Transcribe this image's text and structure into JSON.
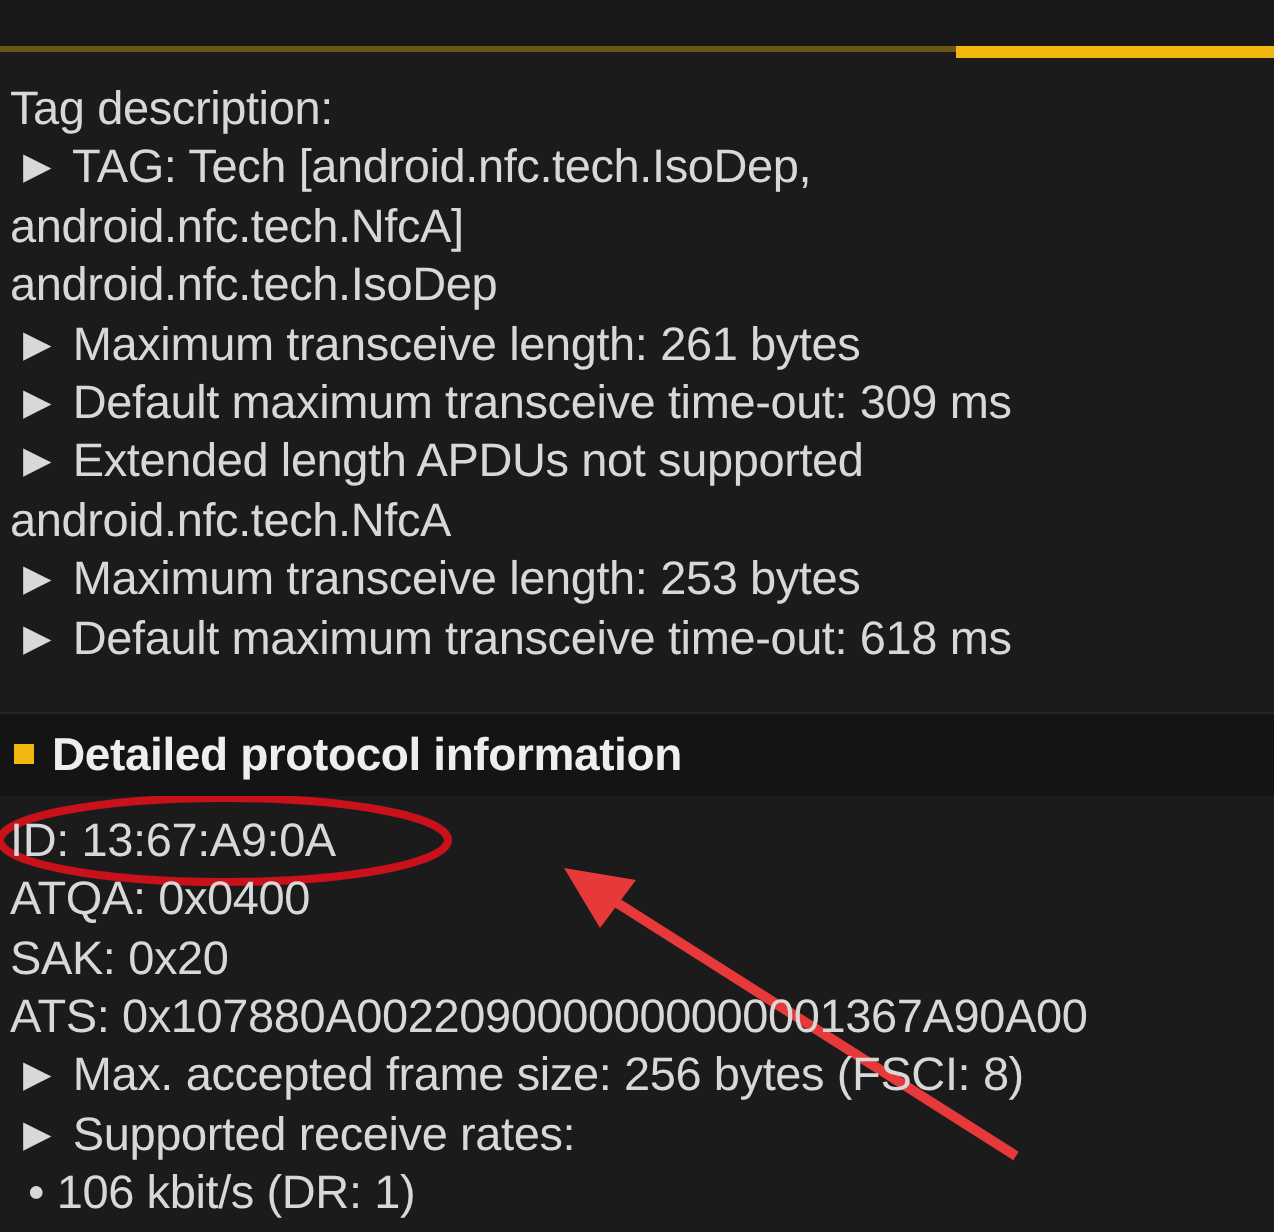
{
  "tabs": [
    {
      "selected": false
    },
    {
      "selected": false
    },
    {
      "selected": false
    },
    {
      "selected": true
    }
  ],
  "tag_description": {
    "heading": "Tag description:",
    "lines": [
      {
        "kind": "bullet",
        "text": "► TAG: Tech [android.nfc.tech.IsoDep,"
      },
      {
        "kind": "plain",
        "text": "android.nfc.tech.NfcA]"
      },
      {
        "kind": "plain",
        "text": "android.nfc.tech.IsoDep"
      },
      {
        "kind": "bullet",
        "text": "► Maximum transceive length: 261 bytes"
      },
      {
        "kind": "bullet",
        "text": "► Default maximum transceive time-out: 309 ms"
      },
      {
        "kind": "bullet",
        "text": "► Extended length APDUs not supported"
      },
      {
        "kind": "plain",
        "text": "android.nfc.tech.NfcA"
      },
      {
        "kind": "bullet",
        "text": "► Maximum transceive length: 253 bytes"
      },
      {
        "kind": "bullet",
        "text": "► Default maximum transceive time-out: 618 ms"
      }
    ]
  },
  "protocol_section": {
    "title": "Detailed protocol information",
    "lines": [
      {
        "kind": "plain",
        "text": "ID: 13:67:A9:0A"
      },
      {
        "kind": "plain",
        "text": "ATQA: 0x0400"
      },
      {
        "kind": "plain",
        "text": "SAK: 0x20"
      },
      {
        "kind": "plain",
        "text": "ATS: 0x107880A0022090000000000001367A90A00"
      },
      {
        "kind": "bullet",
        "text": "► Max. accepted frame size: 256 bytes (FSCI: 8)"
      },
      {
        "kind": "bullet",
        "text": "► Supported receive rates:"
      },
      {
        "kind": "dot",
        "text": "• 106 kbit/s (DR: 1)"
      }
    ]
  }
}
